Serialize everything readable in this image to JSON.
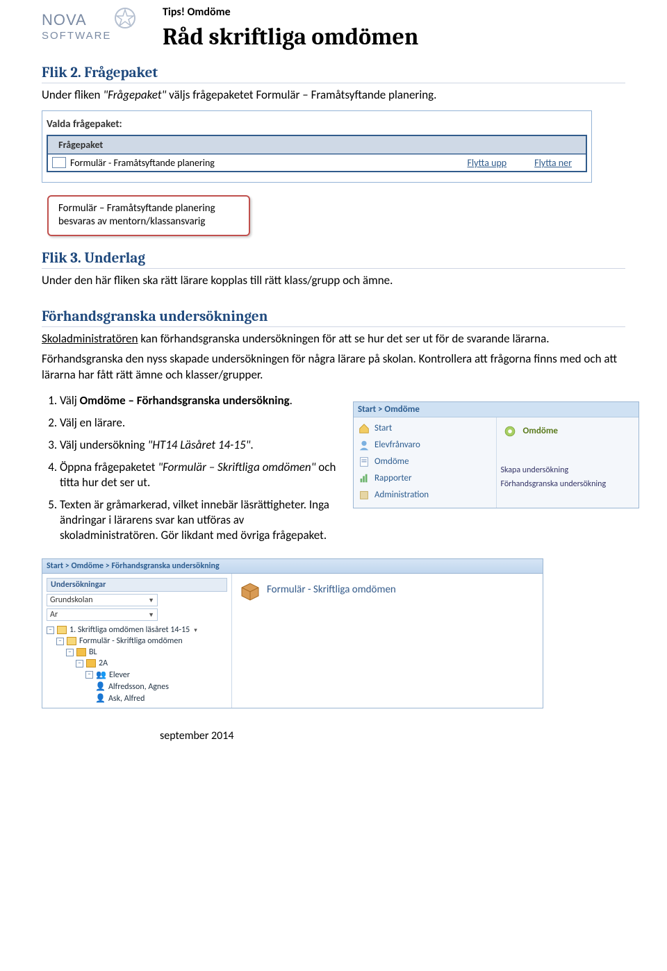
{
  "header": {
    "tips": "Tips! Omdöme",
    "title": "Råd skriftliga omdömen"
  },
  "logo": {
    "top": "NOVA",
    "bottom": "SOFTWARE"
  },
  "s1": {
    "h": "Flik 2. Frågepaket",
    "p_a": "Under fliken ",
    "p_it": "\"Frågepaket\"",
    "p_b": " väljs frågepaketet Formulär – Framåtsyftande planering."
  },
  "shot1": {
    "caption": "Valda frågepaket:",
    "th": "Frågepaket",
    "row1": "Formulär - Framåtsyftande planering",
    "link1": "Flytta upp",
    "link2": "Flytta ner"
  },
  "callout": "Formulär – Framåtsyftande planering besvaras av mentorn/klassansvarig",
  "s2": {
    "h": "Flik 3. Underlag",
    "p": "Under den här fliken ska rätt lärare kopplas till rätt klass/grupp och ämne."
  },
  "s3": {
    "h": "Förhandsgranska undersökningen",
    "p1_u": "Skoladministratören",
    "p1_rest": " kan förhandsgranska undersökningen för att se hur det ser ut för de svarande lärarna.",
    "p2": "Förhandsgranska den nyss skapade undersökningen för några lärare på skolan. Kontrollera att frågorna finns med och att lärarna har fått rätt ämne och klasser/grupper."
  },
  "steps": {
    "s1_a": "Välj ",
    "s1_b": "Omdöme – Förhandsgranska undersökning",
    "s1_c": ".",
    "s2": "Välj en lärare.",
    "s3_a": "Välj undersökning ",
    "s3_it": "\"HT14 Läsåret 14-15\"",
    "s3_b": ".",
    "s4_a": "Öppna frågepaketet ",
    "s4_it": "\"Formulär – Skriftliga omdömen\"",
    "s4_b": " och titta hur det ser ut.",
    "s5": "Texten är gråmarkerad, vilket innebär läsrättigheter. Inga ändringar i lärarens svar kan utföras av skoladministratören. Gör likdant med övriga frågepaket."
  },
  "shot2": {
    "bc": "Start > Omdöme",
    "left": {
      "start": "Start",
      "elev": "Elevfrånvaro",
      "omd": "Omdöme",
      "rapp": "Rapporter",
      "admin": "Administration"
    },
    "right": {
      "omd": "Omdöme",
      "skapa": "Skapa undersökning",
      "fh": "Förhandsgranska undersökning"
    }
  },
  "shot3": {
    "bc": "Start > Omdöme > Förhandsgranska undersökning",
    "hdr": "Undersökningar",
    "d1": "Grundskolan",
    "d2": "Ar",
    "n1": "1. Skriftliga omdömen läsåret 14-15",
    "n2": "Formulär - Skriftliga omdömen",
    "n3": "BL",
    "n4": "2A",
    "n5": "Elever",
    "n6": "Alfredsson, Agnes",
    "n7": "Ask, Alfred",
    "right": "Formulär - Skriftliga omdömen"
  },
  "footer": "september 2014"
}
